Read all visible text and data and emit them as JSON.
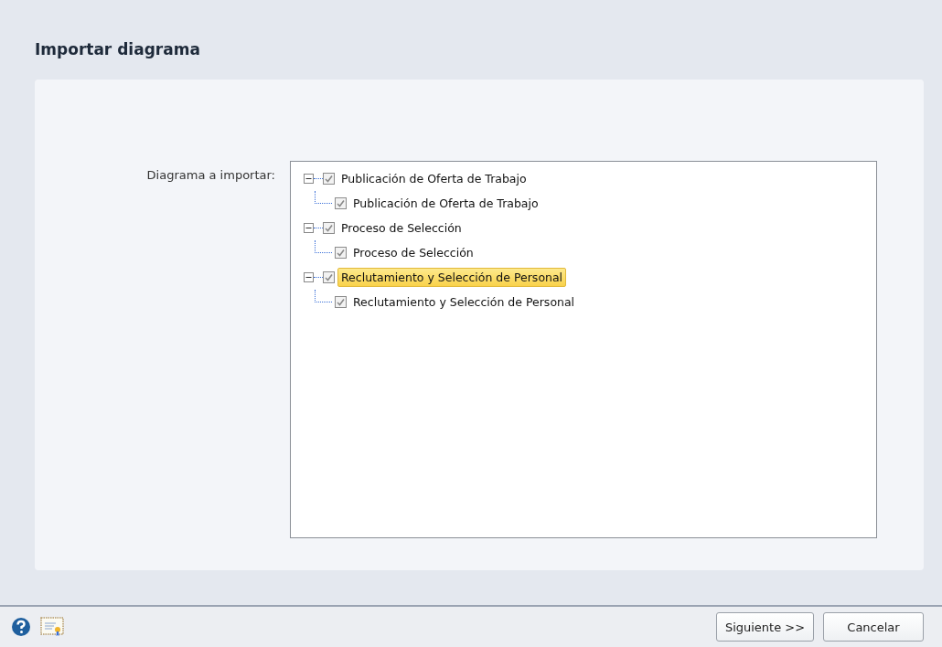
{
  "title": "Importar diagrama",
  "field_label": "Diagrama a importar:",
  "tree": [
    {
      "label": "Publicación de Oferta de Trabajo",
      "checked": true,
      "expanded": true,
      "selected": false,
      "children": [
        {
          "label": "Publicación de Oferta de Trabajo",
          "checked": true,
          "selected": false
        }
      ]
    },
    {
      "label": "Proceso de Selección",
      "checked": true,
      "expanded": true,
      "selected": false,
      "children": [
        {
          "label": "Proceso de Selección",
          "checked": true,
          "selected": false
        }
      ]
    },
    {
      "label": "Reclutamiento y Selección de Personal",
      "checked": true,
      "expanded": true,
      "selected": true,
      "children": [
        {
          "label": "Reclutamiento y Selección de Personal",
          "checked": true,
          "selected": false
        }
      ]
    }
  ],
  "buttons": [
    "Siguiente >>",
    "Cancelar"
  ]
}
